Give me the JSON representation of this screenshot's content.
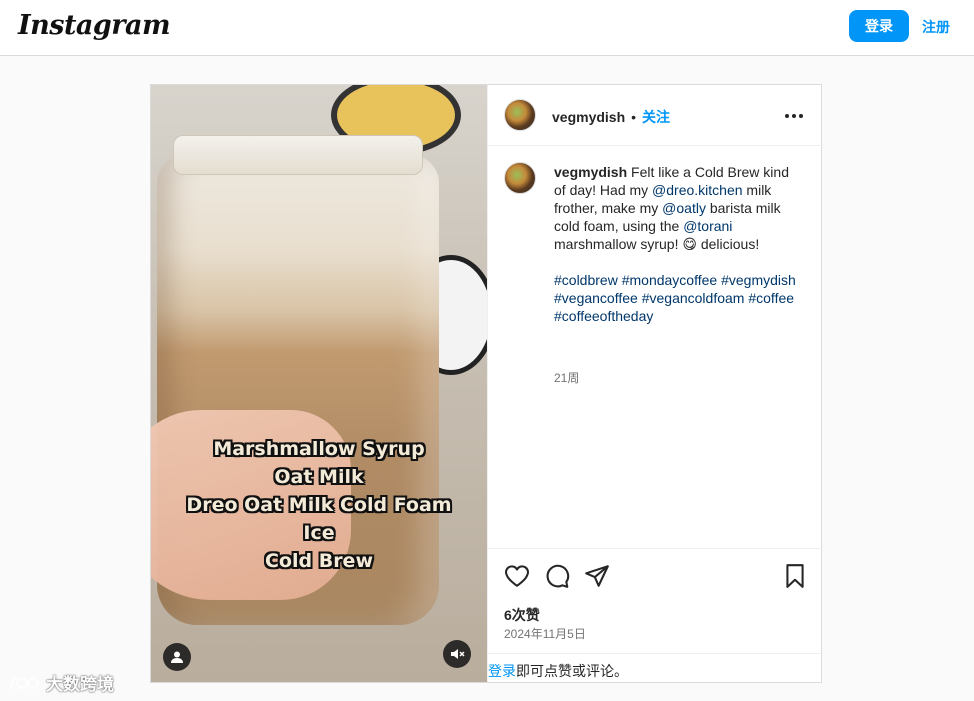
{
  "header": {
    "logo": "Instagram",
    "login_label": "登录",
    "signup_label": "注册"
  },
  "post": {
    "username": "vegmydish",
    "separator": "•",
    "follow_label": "关注",
    "more_label": "•••",
    "caption": {
      "username": "vegmydish",
      "text_1": " Felt like a Cold Brew kind of day! Had my ",
      "mention_1": "@dreo.kitchen",
      "text_2": " milk frother, make my ",
      "mention_2": "@oatly",
      "text_3": " barista milk cold foam, using the ",
      "mention_3": "@torani",
      "text_4": " marshmallow syrup! 😋 delicious!",
      "hashtags": [
        "#coldbrew",
        "#mondaycoffee",
        "#vegmydish",
        "#vegancoffee",
        "#vegancoldfoam",
        "#coffee",
        "#coffeeoftheday"
      ],
      "age": "21周"
    },
    "media_overlay_lines": [
      "Marshmallow Syrup",
      "Oat Milk",
      "Dreo Oat Milk Cold Foam",
      "Ice",
      "Cold Brew"
    ],
    "likes": "6次赞",
    "date": "2024年11月5日",
    "footer_link": "登录",
    "footer_text": "即可点赞或评论。",
    "icons": {
      "like": "heart-icon",
      "comment": "comment-icon",
      "share": "send-icon",
      "save": "bookmark-icon",
      "tagged": "user-icon",
      "mute": "speaker-muted-icon"
    }
  },
  "watermark": "大数跨境",
  "colors": {
    "accent": "#0095f6",
    "tag": "#00376b",
    "muted": "#737373"
  }
}
